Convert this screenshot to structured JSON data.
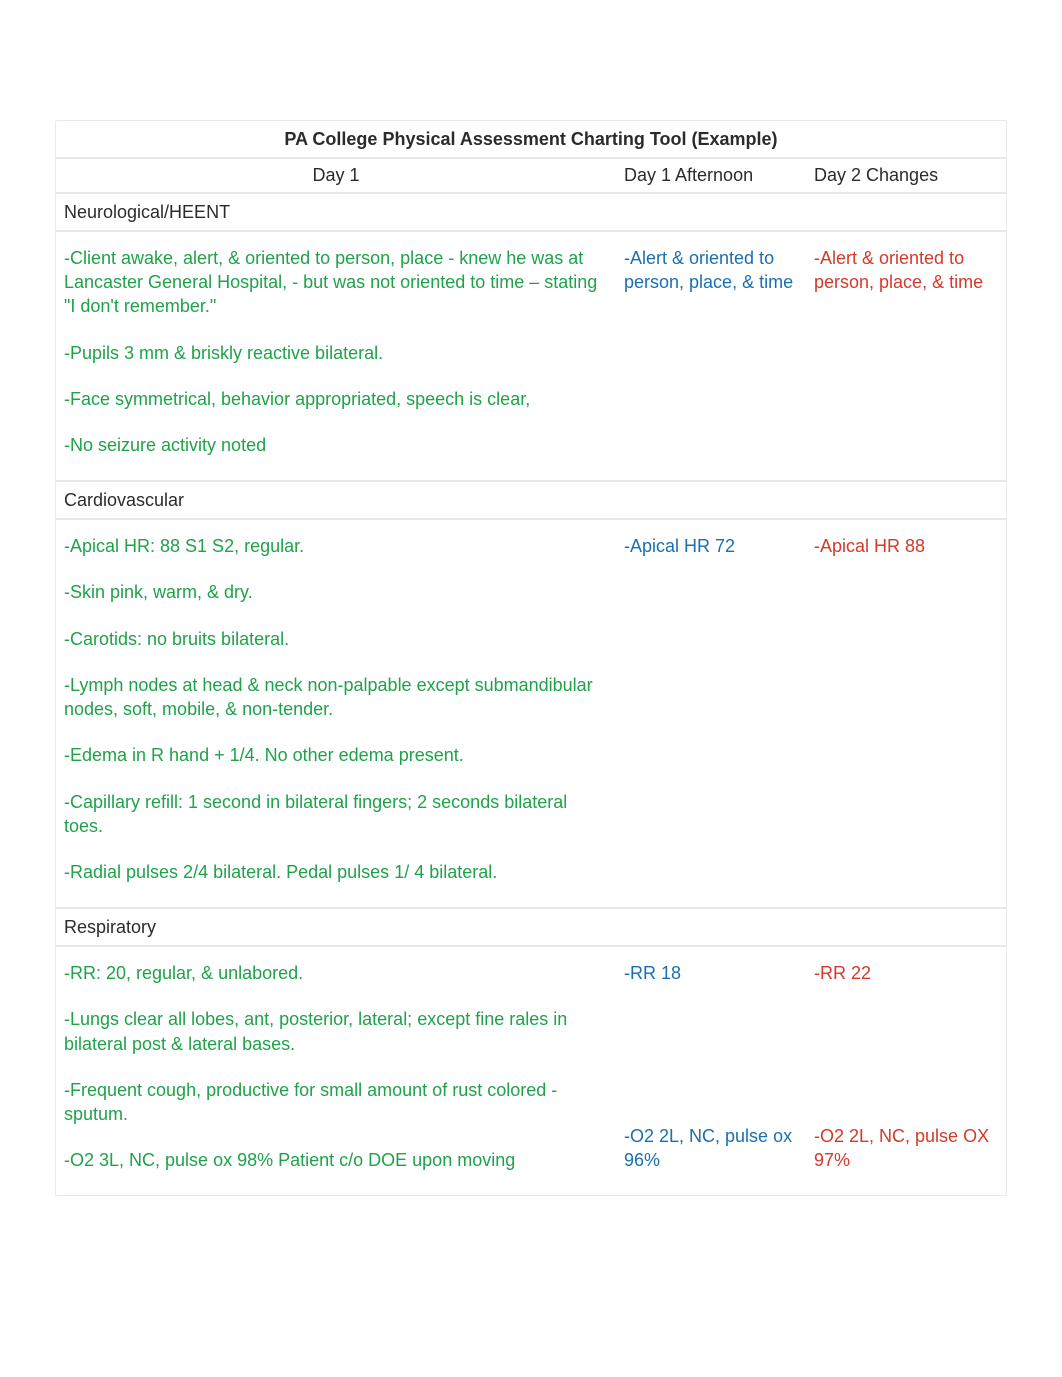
{
  "title": "PA College Physical Assessment Charting Tool (Example)",
  "columns": {
    "day1": "Day 1",
    "day1pm": "Day 1 Afternoon",
    "day2": "Day 2 Changes"
  },
  "sections": [
    {
      "label": "Neurological/HEENT",
      "day1": [
        "-Client awake, alert, & oriented to person, place - knew he was at Lancaster General Hospital, - but was not oriented to time – stating \"I don't remember.\"",
        "-Pupils 3 mm & briskly reactive bilateral.",
        "-Face symmetrical, behavior appropriated, speech is clear,",
        "-No seizure activity noted"
      ],
      "day1pm": [
        {
          "text": "-Alert & oriented to person, place, & time",
          "cls": "blue"
        }
      ],
      "day2": [
        {
          "text": "-Alert & oriented to person, place, & time",
          "cls": "red"
        }
      ]
    },
    {
      "label": "Cardiovascular",
      "day1": [
        "-Apical HR: 88 S1 S2, regular.",
        "-Skin pink, warm, & dry.",
        "-Carotids: no bruits bilateral.",
        "-Lymph nodes at head & neck non-palpable except submandibular nodes, soft, mobile, & non-tender.",
        "-Edema in R hand + 1/4. No other edema present.",
        "-Capillary refill: 1 second in bilateral fingers; 2 seconds bilateral toes.",
        "-Radial pulses 2/4 bilateral. Pedal pulses 1/ 4 bilateral."
      ],
      "day1pm": [
        {
          "text": "-Apical HR 72",
          "cls": "blue"
        }
      ],
      "day2": [
        {
          "text": "-Apical HR 88",
          "cls": "red"
        }
      ]
    },
    {
      "label": "Respiratory",
      "day1": [
        "-RR: 20, regular, & unlabored.",
        "-Lungs clear all lobes, ant, posterior, lateral; except fine rales in bilateral post & lateral bases.",
        "-Frequent cough, productive for small amount of rust colored -sputum.",
        "-O2 3L, NC, pulse ox 98% Patient c/o DOE upon moving"
      ],
      "day1pm": [
        {
          "text": "-RR 18",
          "cls": "blue"
        },
        {
          "text": "-O2 2L, NC, pulse ox 96%",
          "cls": "blue"
        }
      ],
      "day2": [
        {
          "text": "-RR 22",
          "cls": "red"
        },
        {
          "text": "-O2 2L, NC, pulse OX 97%",
          "cls": "red"
        }
      ]
    }
  ]
}
